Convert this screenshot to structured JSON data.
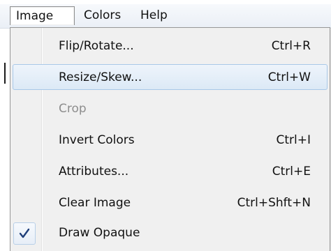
{
  "menubar": {
    "items": [
      {
        "label": "Image"
      },
      {
        "label": "Colors"
      },
      {
        "label": "Help"
      }
    ]
  },
  "image_menu": {
    "items": [
      {
        "label": "Flip/Rotate...",
        "shortcut": "Ctrl+R",
        "state": "normal"
      },
      {
        "label": "Resize/Skew...",
        "shortcut": "Ctrl+W",
        "state": "highlighted"
      },
      {
        "label": "Crop",
        "shortcut": "",
        "state": "disabled"
      },
      {
        "label": "Invert Colors",
        "shortcut": "Ctrl+I",
        "state": "normal"
      },
      {
        "label": "Attributes...",
        "shortcut": "Ctrl+E",
        "state": "normal"
      },
      {
        "label": "Clear Image",
        "shortcut": "Ctrl+Shft+N",
        "state": "normal"
      },
      {
        "label": "Draw Opaque",
        "shortcut": "",
        "state": "checked"
      }
    ]
  },
  "icons": {
    "check": "check-icon"
  },
  "colors": {
    "highlight_border": "#a8c8e8",
    "check_mark": "#1f3f7a",
    "disabled_text": "#8d8d8d"
  }
}
